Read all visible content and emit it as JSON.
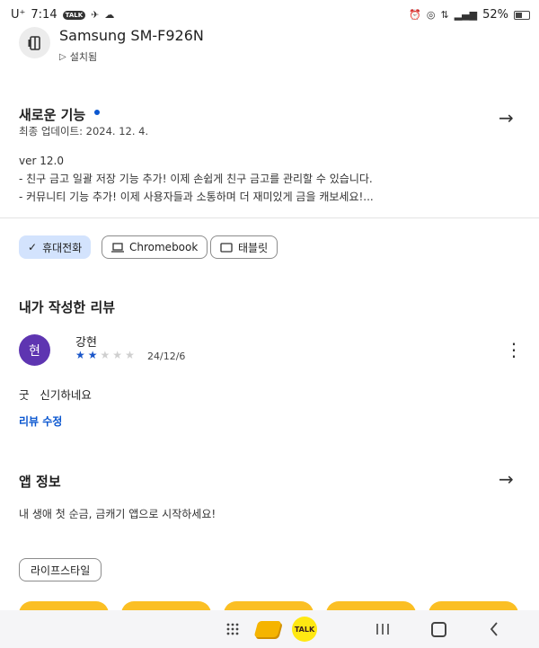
{
  "status_bar": {
    "carrier": "U⁺",
    "time": "7:14",
    "battery": "52%"
  },
  "device": {
    "name": "Samsung SM-F926N",
    "status": "설치됨"
  },
  "whats_new": {
    "title": "새로운 기능",
    "updated": "최종 업데이트: 2024. 12. 4.",
    "version": "ver 12.0",
    "line1": "- 친구 금고 일괄 저장 기능 추가! 이제 손쉽게 친구 금고를 관리할 수 있습니다.",
    "line2": "- 커뮤니티 기능 추가! 이제 사용자들과 소통하며 더 재미있게 금을 캐보세요!..."
  },
  "device_chips": [
    {
      "label": "휴대전화",
      "selected": true
    },
    {
      "label": "Chromebook",
      "selected": false
    },
    {
      "label": "태블릿",
      "selected": false
    }
  ],
  "my_review": {
    "title": "내가 작성한 리뷰",
    "avatar_letter": "현",
    "author": "강현",
    "rating": 2,
    "rating_max": 5,
    "date": "24/12/6",
    "text": "굿   신기하네요",
    "edit_label": "리뷰 수정"
  },
  "app_info": {
    "title": "앱 정보",
    "description": "내 생애 첫 순금, 금캐기 앱으로 시작하세요!",
    "category": "라이프스타일"
  },
  "nav": {
    "talk_label": "TALK"
  },
  "colors": {
    "accent": "#0b57d0",
    "chip_selected": "#d3e3fd",
    "avatar": "#5e35b1",
    "card_yellow": "#fbbf24"
  }
}
